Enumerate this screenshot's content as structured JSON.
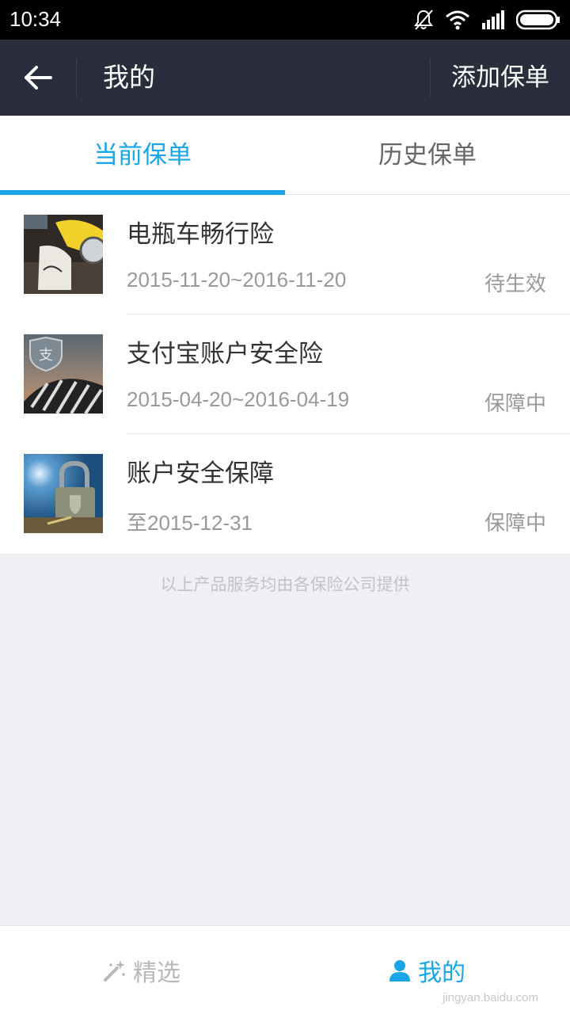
{
  "status_bar": {
    "time": "10:34"
  },
  "nav": {
    "title": "我的",
    "action": "添加保单"
  },
  "tabs": [
    {
      "label": "当前保单",
      "active": true
    },
    {
      "label": "历史保单",
      "active": false
    }
  ],
  "policies": [
    {
      "name": "电瓶车畅行险",
      "period": "2015-11-20~2016-11-20",
      "status": "待生效"
    },
    {
      "name": "支付宝账户安全险",
      "period": "2015-04-20~2016-04-19",
      "status": "保障中"
    },
    {
      "name": "账户安全保障",
      "period": "至2015-12-31",
      "status": "保障中"
    }
  ],
  "footer_note": "以上产品服务均由各保险公司提供",
  "bottom_nav": {
    "featured": "精选",
    "mine": "我的"
  },
  "watermark": "jingyan.baidu.com",
  "colors": {
    "accent": "#1aa5e6",
    "nav_bg": "#2a2d3c",
    "page_bg": "#efeff4"
  }
}
